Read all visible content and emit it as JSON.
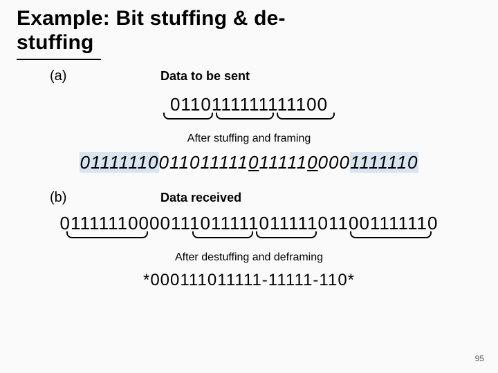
{
  "title_line1": "Example:  Bit stuffing & de-",
  "title_line2": "stuffing",
  "partA": {
    "label": "(a)",
    "caption1": "Data to be sent",
    "bits1": "0110111111111100",
    "caption2": "After stuffing and framing",
    "stuffed": {
      "flag_open": "01111110",
      "seg1": "011011111",
      "ins1": "0",
      "seg2": "11111",
      "ins2": "0",
      "seg3": "000",
      "flag_close": "1111110"
    }
  },
  "partB": {
    "label": "(b)",
    "caption1": "Data received",
    "bits_received": "01111110000111011111011111011001111110",
    "caption2": "After destuffing and deframing",
    "bits_destuffed": "*000111011111-11111-110*"
  },
  "slide_number": "95"
}
